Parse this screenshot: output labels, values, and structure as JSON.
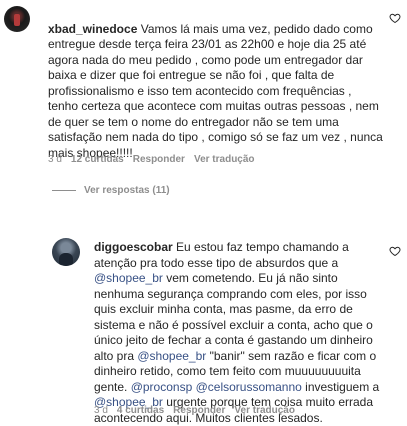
{
  "comment1": {
    "username": "xbad_winedoce",
    "text": "Vamos lá mais uma vez, pedido dado como entregue desde terça feira 23/01 as 22h00 e hoje dia 25 até agora nada do meu pedido , como pode um entregador dar baixa e dizer que foi entregue se não foi , que falta de profissionalismo e isso tem acontecido com frequências , tenho certeza que acontece com muitas outras pessoas , nem de quer se tem o nome do entregador não se tem uma satisfação nem nada do tipo , comigo só se faz um vez , nunca mais shopee!!!!!",
    "time": "3 d",
    "likes": "12 curtidas",
    "reply_label": "Responder",
    "translate_label": "Ver tradução"
  },
  "view_replies": {
    "label": "Ver respostas (11)"
  },
  "comment2": {
    "username": "diggoescobar",
    "segments": [
      {
        "t": "Eu estou faz tempo chamando a\natenção pra todo esse tipo de absurdos que a\n",
        "m": false
      },
      {
        "t": "@shopee_br",
        "m": true
      },
      {
        "t": " vem cometendo. Eu já não sinto\nnenhuma segurança comprando com eles, por isso\nquis excluir minha conta, mas pasme, da erro de\nsistema e não é possível excluir a conta, acho que o\núnico jeito de fechar a conta é gastando um dinheiro\nalto pra ",
        "m": false
      },
      {
        "t": "@shopee_br",
        "m": true
      },
      {
        "t": " \"banir\" sem razão e ficar com o\ndinheiro retido, como tem feito com muuuuuuuuita\ngente. ",
        "m": false
      },
      {
        "t": "@proconsp",
        "m": true
      },
      {
        "t": " ",
        "m": false
      },
      {
        "t": "@celsorussomanno",
        "m": true
      },
      {
        "t": " investiguem a\n",
        "m": false
      },
      {
        "t": "@shopee_br",
        "m": true
      },
      {
        "t": " urgente porque tem coisa muito errada\nacontecendo aqui. Muitos clientes lesados.",
        "m": false
      }
    ],
    "time": "3 d",
    "likes": "4 curtidas",
    "reply_label": "Responder",
    "translate_label": "Ver tradução"
  },
  "icons": {
    "like1": "heart-outline-icon",
    "like2": "heart-outline-icon"
  }
}
